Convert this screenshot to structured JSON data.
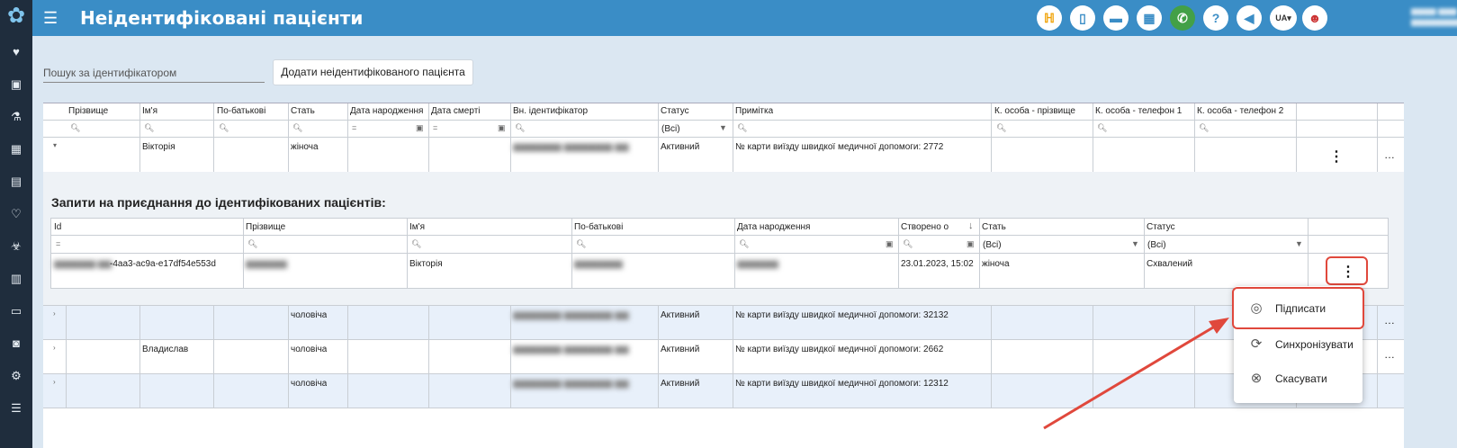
{
  "header": {
    "title": "Неідентифіковані пацієнти",
    "lang": "UA",
    "icons": [
      "helpdesk-icon",
      "pdf-icon",
      "card-icon",
      "calculator-icon",
      "phone-icon",
      "help-icon",
      "megaphone-icon",
      "language-icon"
    ]
  },
  "toolbar": {
    "search_placeholder": "Пошук за ідентифікатором",
    "add_button": "Додати неідентифікованого пацієнта"
  },
  "main_table": {
    "columns": [
      "Прізвище",
      "Ім'я",
      "По-батькові",
      "Стать",
      "Дата народження",
      "Дата смерті",
      "Вн. ідентифікатор",
      "Статус",
      "Примітка",
      "К. особа - прізвище",
      "К. особа - телефон 1",
      "К. особа - телефон 2"
    ],
    "status_filter": "(Всі)",
    "rows": [
      {
        "first_name": "Вікторія",
        "gender": "жіноча",
        "status": "Активний",
        "note": "№ карти виїзду швидкої медичної допомоги: 2772"
      },
      {
        "first_name": "",
        "gender": "чоловіча",
        "status": "Активний",
        "note": "№ карти виїзду швидкої медичної допомоги: 32132"
      },
      {
        "first_name": "Владислав",
        "gender": "чоловіча",
        "status": "Активний",
        "note": "№ карти виїзду швидкої медичної допомоги: 2662"
      },
      {
        "first_name": "",
        "gender": "чоловіча",
        "status": "Активний",
        "note": "№ карти виїзду швидкої медичної допомоги: 12312"
      }
    ]
  },
  "requests": {
    "title": "Запити на приєднання до ідентифікованих пацієнтів:",
    "columns": [
      "Id",
      "Прізвище",
      "Ім'я",
      "По-батькові",
      "Дата народження",
      "Створено о",
      "Стать",
      "Статус"
    ],
    "gender_filter": "(Всі)",
    "status_filter": "(Всі)",
    "row": {
      "id_suffix": "-4aa3-ac9a-e17df54e553d",
      "first_name": "Вікторія",
      "created": "23.01.2023, 15:02",
      "gender": "жіноча",
      "status": "Схвалений"
    }
  },
  "context_menu": {
    "items": [
      {
        "label": "Підписати",
        "icon": "fingerprint-icon"
      },
      {
        "label": "Синхронізувати",
        "icon": "sync-icon"
      },
      {
        "label": "Скасувати",
        "icon": "cancel-icon"
      }
    ]
  },
  "colors": {
    "topbar": "#3a8dc6",
    "sidebar": "#1f2d3d",
    "highlight": "#e0483c"
  }
}
